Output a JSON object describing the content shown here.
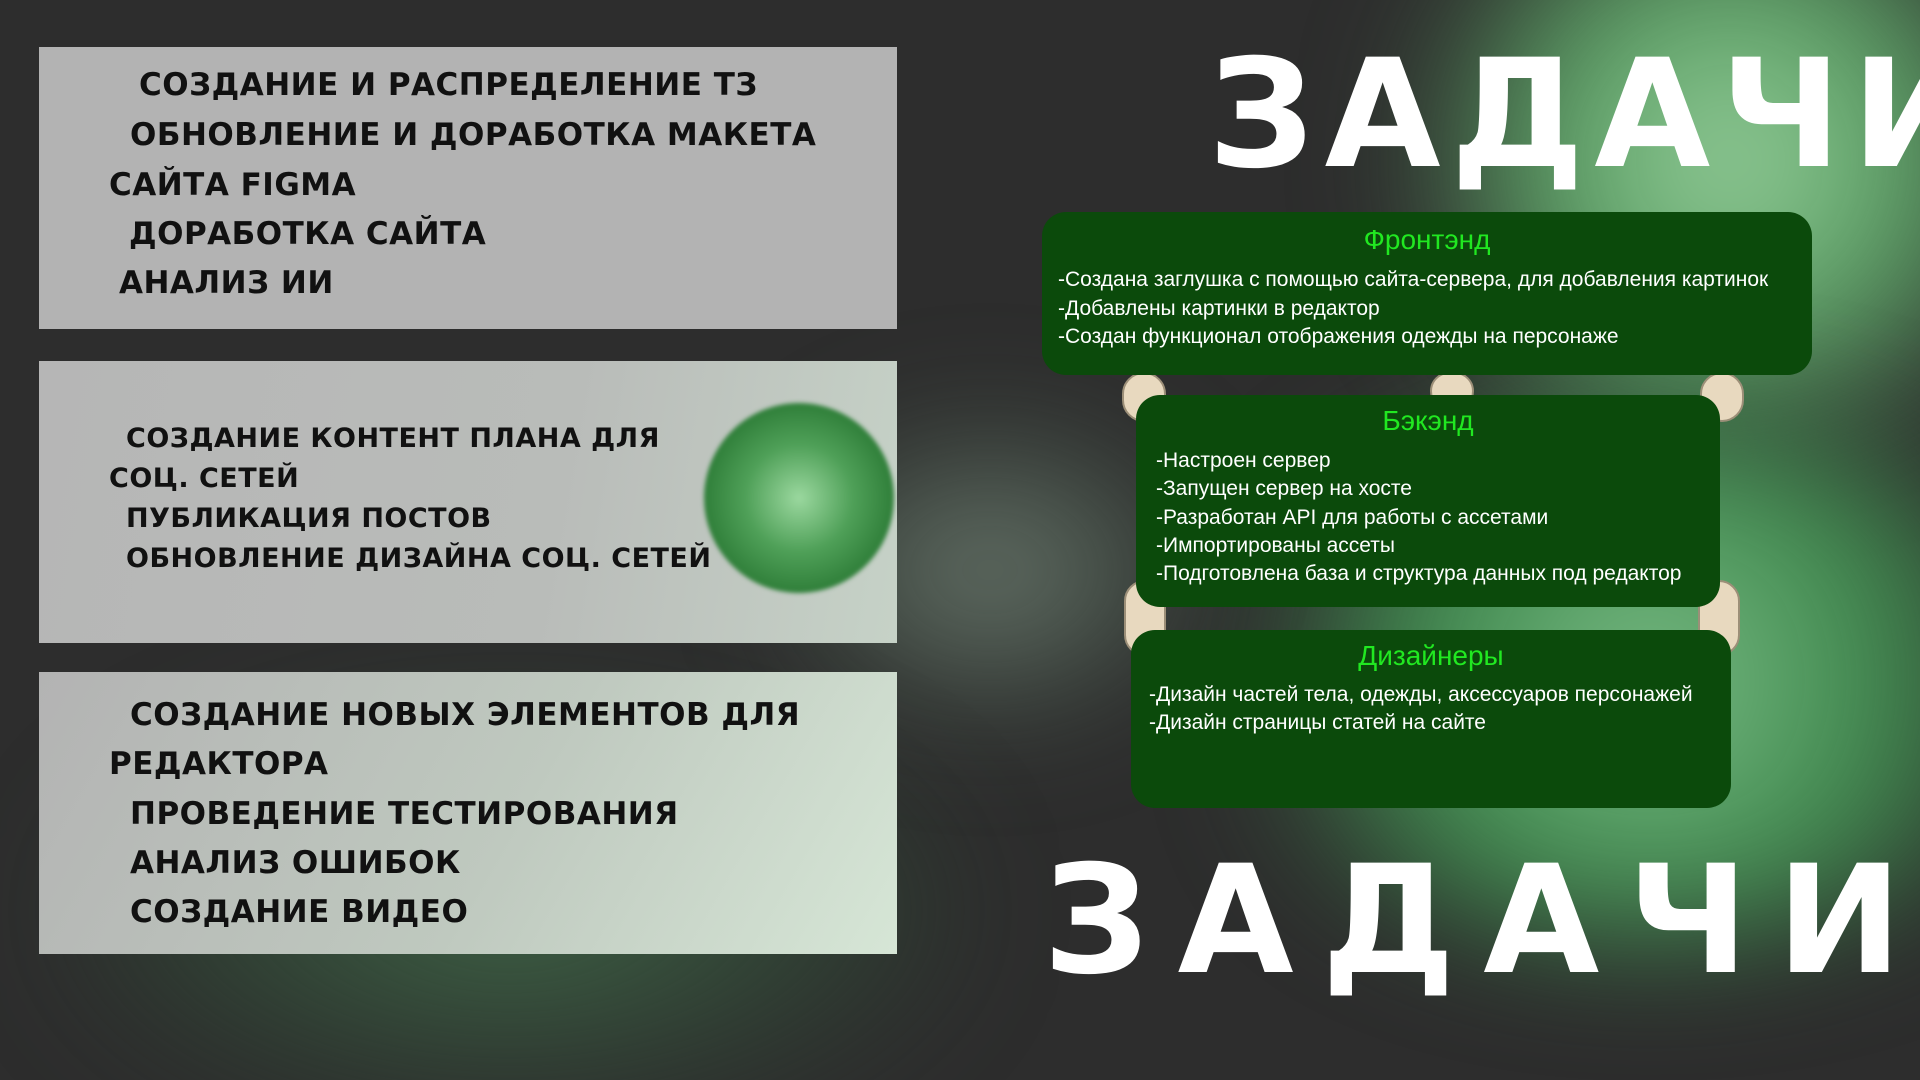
{
  "panels": [
    {
      "lines": [
        "Создание и распределение ТЗ",
        "Обновление и доработка макета",
        "сайта  Figma",
        "Доработка сайта",
        "Анализ ИИ"
      ]
    },
    {
      "lines": [
        "Создание контент плана для",
        "соц. сетей",
        "Публикация постов",
        "Обновление дизайна соц. сетей"
      ]
    },
    {
      "lines": [
        "Создание новых элементов для",
        "редактора",
        "Проведение тестирования",
        "Анализ ошибок",
        "Создание видео"
      ]
    }
  ],
  "headline_top": "ЗАДАЧИ",
  "headline_bottom": "ЗАДАЧИ",
  "cards": {
    "frontend": {
      "title": "Фронтэнд",
      "items": [
        "-Создана заглушка с помощью сайта-сервера, для добавления картинок",
        "-Добавлены картинки в редактор",
        "-Создан функционал отображения одежды на персонаже"
      ]
    },
    "backend": {
      "title": "Бэкэнд",
      "items": [
        "-Настроен сервер",
        "-Запущен сервер на хосте",
        "-Разработан API для работы с ассетами",
        "-Импортированы ассеты",
        "-Подготовлена база и структура данных под редактор"
      ]
    },
    "designers": {
      "title": "Дизайнеры",
      "items": [
        "-Дизайн частей тела, одежды, аксессуаров персонажей",
        "-Дизайн страницы статей на сайте"
      ]
    }
  },
  "colors": {
    "background": "#2d2d2d",
    "panel": "#b3b3b3",
    "card": "#0b4a0b",
    "card_title": "#21e821",
    "headline": "#ffffff"
  }
}
